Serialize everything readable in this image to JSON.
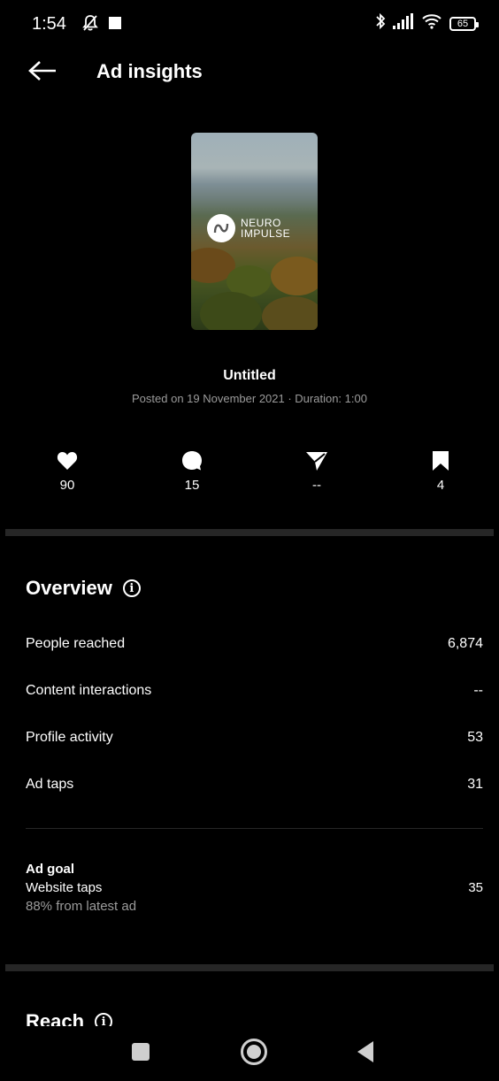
{
  "status_bar": {
    "time": "1:54",
    "battery": "65"
  },
  "header": {
    "title": "Ad insights"
  },
  "post": {
    "logo_line1": "NEURO",
    "logo_line2": "IMPULSE",
    "title": "Untitled",
    "meta": "Posted on 19 November 2021 · Duration: 1:00"
  },
  "stats": {
    "likes": "90",
    "comments": "15",
    "shares": "--",
    "saves": "4"
  },
  "overview": {
    "title": "Overview",
    "info_symbol": "i",
    "rows": [
      {
        "label": "People reached",
        "value": "6,874"
      },
      {
        "label": "Content interactions",
        "value": "--"
      },
      {
        "label": "Profile activity",
        "value": "53"
      },
      {
        "label": "Ad taps",
        "value": "31"
      }
    ]
  },
  "ad_goal": {
    "title": "Ad goal",
    "label": "Website taps",
    "value": "35",
    "sub": "88% from latest ad"
  },
  "reach": {
    "title": "Reach",
    "info_symbol": "i"
  },
  "icons": {
    "back": "arrow-left-icon",
    "like": "heart-icon",
    "comment": "comment-bubble-icon",
    "share": "send-icon",
    "save": "bookmark-icon",
    "info": "info-icon"
  }
}
